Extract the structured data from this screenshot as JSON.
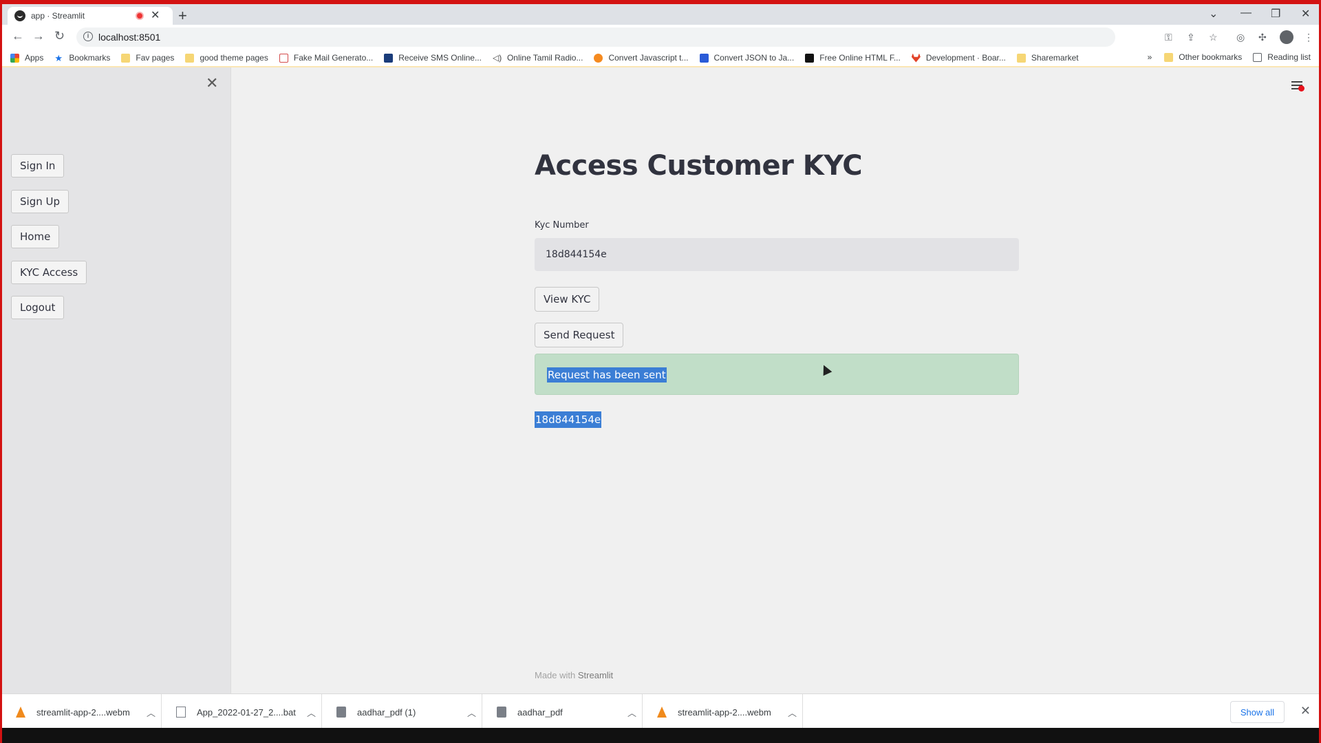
{
  "browser": {
    "tab": {
      "title": "app · Streamlit"
    },
    "url": "localhost:8501",
    "bookmarks": [
      {
        "label": "Apps",
        "icon": "apps-grid-icon"
      },
      {
        "label": "Bookmarks",
        "icon": "star-icon"
      },
      {
        "label": "Fav pages",
        "icon": "folder-icon"
      },
      {
        "label": "good theme pages",
        "icon": "folder-icon"
      },
      {
        "label": "Fake Mail Generato...",
        "icon": "mail-icon"
      },
      {
        "label": "Receive SMS Online...",
        "icon": "sms-icon"
      },
      {
        "label": "Online Tamil Radio...",
        "icon": "radio-icon"
      },
      {
        "label": "Convert Javascript t...",
        "icon": "converter-icon"
      },
      {
        "label": "Convert JSON to Ja...",
        "icon": "json-icon"
      },
      {
        "label": "Free Online HTML F...",
        "icon": "html-icon"
      },
      {
        "label": "Development · Boar...",
        "icon": "gitlab-icon"
      },
      {
        "label": "Sharemarket",
        "icon": "folder-icon"
      }
    ],
    "bookmarks_right": [
      {
        "label": "Other bookmarks"
      },
      {
        "label": "Reading list"
      }
    ]
  },
  "sidebar": {
    "buttons": [
      "Sign In",
      "Sign Up",
      "Home",
      "KYC Access",
      "Logout"
    ]
  },
  "main": {
    "title": "Access Customer KYC",
    "kyc_label": "Kyc Number",
    "kyc_value": "18d844154e",
    "view_button": "View KYC",
    "send_button": "Send Request",
    "success_message": "Request has been sent",
    "output_text": "18d844154e",
    "footer_prefix": "Made with",
    "footer_brand": "Streamlit"
  },
  "downloads": [
    {
      "name": "streamlit-app-2....webm",
      "icon": "vlc-icon"
    },
    {
      "name": "App_2022-01-27_2....bat",
      "icon": "batch-file-icon"
    },
    {
      "name": "aadhar_pdf (1)",
      "icon": "file-icon"
    },
    {
      "name": "aadhar_pdf",
      "icon": "file-icon"
    },
    {
      "name": "streamlit-app-2....webm",
      "icon": "vlc-icon"
    }
  ],
  "show_all": "Show all",
  "colors": {
    "success_bg": "#c1dec8",
    "selection": "#3b7ed5",
    "status_dot": "#e8121c"
  }
}
